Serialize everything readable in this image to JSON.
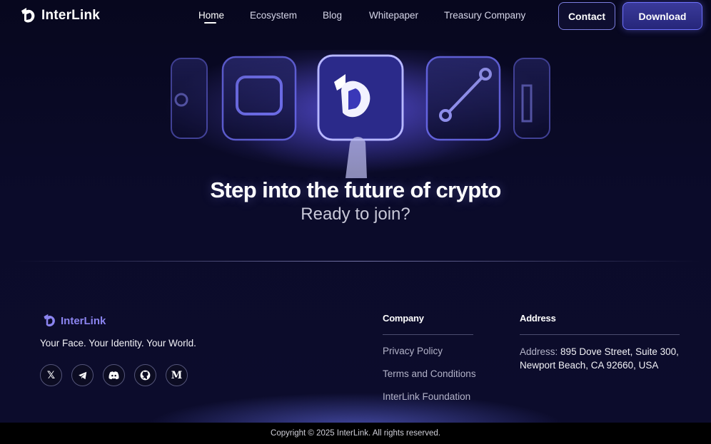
{
  "nav": {
    "brand": "InterLink",
    "links": [
      {
        "label": "Home"
      },
      {
        "label": "Ecosystem"
      },
      {
        "label": "Blog"
      },
      {
        "label": "Whitepaper"
      },
      {
        "label": "Treasury Company"
      }
    ],
    "contact_label": "Contact",
    "download_label": "Download"
  },
  "hero": {
    "title": "Step into the future of crypto",
    "subtitle": "Ready to join?"
  },
  "footer": {
    "brand": "InterLink",
    "tagline": "Your Face. Your Identity. Your World.",
    "socials": [
      {
        "icon": "x-icon",
        "glyph": "𝕏"
      },
      {
        "icon": "telegram-icon",
        "glyph": ""
      },
      {
        "icon": "discord-icon",
        "glyph": ""
      },
      {
        "icon": "github-icon",
        "glyph": ""
      },
      {
        "icon": "medium-icon",
        "glyph": "M"
      }
    ],
    "company": {
      "title": "Company",
      "links": [
        "Privacy Policy",
        "Terms and Conditions",
        "InterLink Foundation"
      ]
    },
    "address": {
      "title": "Address",
      "label": "Address:",
      "value": "895 Dove Street, Suite 300, Newport Beach, CA 92660, USA"
    },
    "copyright": "Copyright © 2025 InterLink. All rights reserved."
  },
  "colors": {
    "background": "#0a0a26",
    "accent": "#6f72ff",
    "brand_purple": "#8b84f0"
  }
}
